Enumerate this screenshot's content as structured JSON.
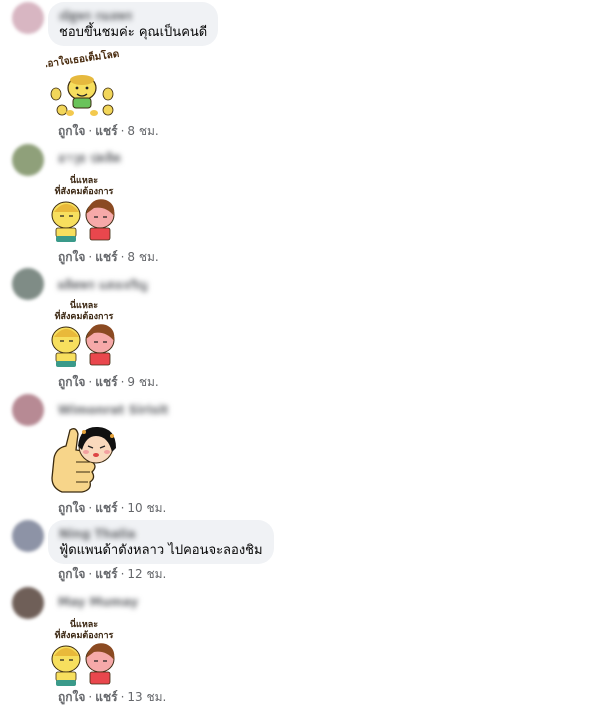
{
  "actions": {
    "like": "ถูกใจ",
    "separator": "·",
    "share": "แชร์"
  },
  "comments": [
    {
      "name": "ณัฐพร กมลพร",
      "avatar_color": "#d8b6c2",
      "text": "ชอบขึ้นชมค่ะ คุณเป็นคนดี",
      "sticker": {
        "name": "cheer-sticker",
        "caption": "เอาใจเธอเต็มโลด"
      },
      "time": "8 ชม."
    },
    {
      "name": "อาวุธ ปดลิต",
      "avatar_color": "#8fa07a",
      "sticker": {
        "name": "society-wants-sticker",
        "caption_line1": "นี่แหละ",
        "caption_line2": "ที่สังคมต้องการ"
      },
      "time": "8 ชม."
    },
    {
      "name": "ผลิตพร แสงเจริญ",
      "avatar_color": "#7f8c86",
      "sticker": {
        "name": "society-wants-sticker",
        "caption_line1": "นี่แหละ",
        "caption_line2": "ที่สังคมต้องการ"
      },
      "time": "9 ชม."
    },
    {
      "name": "Wimonrat Sirisit",
      "avatar_color": "#b78a94",
      "sticker": {
        "name": "thumbs-up-sticker"
      },
      "time": "10 ชม."
    },
    {
      "name": "Ning Thalia",
      "avatar_color": "#8d93a6",
      "text": "ฟู้ดแพนด้าดังหลาว ไปคอนจะลองชิม",
      "time": "12 ชม."
    },
    {
      "name": "May Mumay",
      "avatar_color": "#6f5f58",
      "sticker": {
        "name": "society-wants-sticker",
        "caption_line1": "นี่แหละ",
        "caption_line2": "ที่สังคมต้องการ"
      },
      "time": "13 ชม."
    }
  ]
}
